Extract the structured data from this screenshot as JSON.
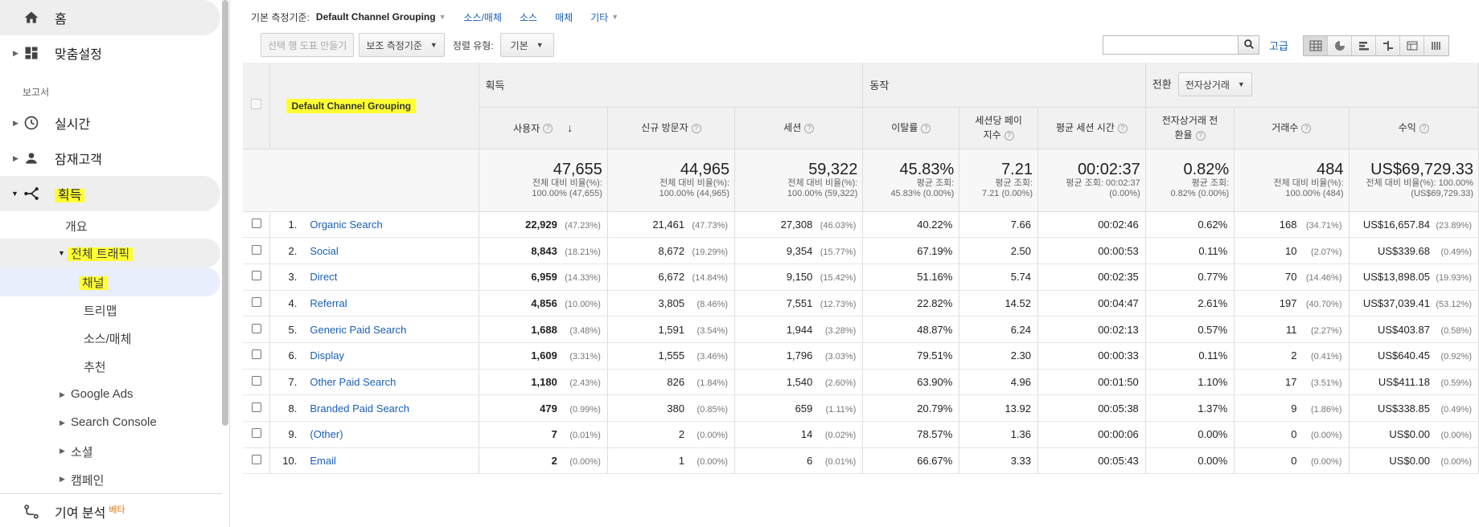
{
  "sidebar": {
    "home": "홈",
    "customization": "맞춤설정",
    "reports_label": "보고서",
    "realtime": "실시간",
    "audience": "잠재고객",
    "acquisition": "획득",
    "overview": "개요",
    "all_traffic": "전체 트래픽",
    "channels": "채널",
    "treemap": "트리맵",
    "source_medium": "소스/매체",
    "referrals": "추천",
    "google_ads": "Google Ads",
    "search_console": "Search Console",
    "social": "소셜",
    "campaigns": "캠페인",
    "attribution": "기여 분석",
    "beta": "베타"
  },
  "dimension_bar": {
    "label": "기본 측정기준:",
    "active": "Default Channel Grouping",
    "links": [
      "소스/매체",
      "소스",
      "매체",
      "기타"
    ]
  },
  "toolbar": {
    "create_tool": "선택 행 도표 만들기",
    "secondary": "보조 측정기준",
    "sort_label": "정렬 유형:",
    "sort_value": "기본",
    "advanced": "고급"
  },
  "table": {
    "dimension_header": "Default Channel Grouping",
    "groups": {
      "acquisition": "획득",
      "behavior": "동작",
      "conversion": "전환",
      "conversion_select": "전자상거래"
    },
    "columns": [
      "사용자",
      "신규 방문자",
      "세션",
      "이탈률",
      "세션당 페이지수",
      "평균 세션 시간",
      "전자상거래 전환율",
      "거래수",
      "수익"
    ],
    "col_users": "사용자",
    "col_new": "신규 방문자",
    "col_sessions": "세션",
    "col_bounce": "이탈률",
    "col_pps_1": "세션당 페이",
    "col_pps_2": "지수",
    "col_avgtime": "평균 세션 시간",
    "col_conv_1": "전자상거래 전",
    "col_conv_2": "환율",
    "col_tx": "거래수",
    "col_rev": "수익",
    "totals": {
      "users": "47,655",
      "users_sub1": "전체 대비 비율(%):",
      "users_sub2": "100.00% (47,655)",
      "new": "44,965",
      "new_sub1": "전체 대비 비율(%):",
      "new_sub2": "100.00% (44,965)",
      "sessions": "59,322",
      "sessions_sub1": "전체 대비 비율(%):",
      "sessions_sub2": "100.00% (59,322)",
      "bounce": "45.83%",
      "bounce_sub1": "평균 조회:",
      "bounce_sub2": "45.83% (0.00%)",
      "pps": "7.21",
      "pps_sub1": "평균 조회:",
      "pps_sub2": "7.21 (0.00%)",
      "avgtime": "00:02:37",
      "avgtime_sub1": "평균 조회: 00:02:37",
      "avgtime_sub2": "(0.00%)",
      "conv": "0.82%",
      "conv_sub1": "평균 조회:",
      "conv_sub2": "0.82% (0.00%)",
      "tx": "484",
      "tx_sub1": "전체 대비 비율(%):",
      "tx_sub2": "100.00% (484)",
      "rev": "US$69,729.33",
      "rev_sub1": "전체 대비 비율(%): 100.00%",
      "rev_sub2": "(US$69,729.33)"
    },
    "rows": [
      {
        "idx": "1.",
        "name": "Organic Search",
        "users": "22,929",
        "users_pct": "(47.23%)",
        "new": "21,461",
        "new_pct": "(47.73%)",
        "sessions": "27,308",
        "sessions_pct": "(46.03%)",
        "bounce": "40.22%",
        "pps": "7.66",
        "avgtime": "00:02:46",
        "conv": "0.62%",
        "tx": "168",
        "tx_pct": "(34.71%)",
        "rev": "US$16,657.84",
        "rev_pct": "(23.89%)"
      },
      {
        "idx": "2.",
        "name": "Social",
        "users": "8,843",
        "users_pct": "(18.21%)",
        "new": "8,672",
        "new_pct": "(19.29%)",
        "sessions": "9,354",
        "sessions_pct": "(15.77%)",
        "bounce": "67.19%",
        "pps": "2.50",
        "avgtime": "00:00:53",
        "conv": "0.11%",
        "tx": "10",
        "tx_pct": "(2.07%)",
        "rev": "US$339.68",
        "rev_pct": "(0.49%)"
      },
      {
        "idx": "3.",
        "name": "Direct",
        "users": "6,959",
        "users_pct": "(14.33%)",
        "new": "6,672",
        "new_pct": "(14.84%)",
        "sessions": "9,150",
        "sessions_pct": "(15.42%)",
        "bounce": "51.16%",
        "pps": "5.74",
        "avgtime": "00:02:35",
        "conv": "0.77%",
        "tx": "70",
        "tx_pct": "(14.46%)",
        "rev": "US$13,898.05",
        "rev_pct": "(19.93%)"
      },
      {
        "idx": "4.",
        "name": "Referral",
        "users": "4,856",
        "users_pct": "(10.00%)",
        "new": "3,805",
        "new_pct": "(8.46%)",
        "sessions": "7,551",
        "sessions_pct": "(12.73%)",
        "bounce": "22.82%",
        "pps": "14.52",
        "avgtime": "00:04:47",
        "conv": "2.61%",
        "tx": "197",
        "tx_pct": "(40.70%)",
        "rev": "US$37,039.41",
        "rev_pct": "(53.12%)"
      },
      {
        "idx": "5.",
        "name": "Generic Paid Search",
        "users": "1,688",
        "users_pct": "(3.48%)",
        "new": "1,591",
        "new_pct": "(3.54%)",
        "sessions": "1,944",
        "sessions_pct": "(3.28%)",
        "bounce": "48.87%",
        "pps": "6.24",
        "avgtime": "00:02:13",
        "conv": "0.57%",
        "tx": "11",
        "tx_pct": "(2.27%)",
        "rev": "US$403.87",
        "rev_pct": "(0.58%)"
      },
      {
        "idx": "6.",
        "name": "Display",
        "users": "1,609",
        "users_pct": "(3.31%)",
        "new": "1,555",
        "new_pct": "(3.46%)",
        "sessions": "1,796",
        "sessions_pct": "(3.03%)",
        "bounce": "79.51%",
        "pps": "2.30",
        "avgtime": "00:00:33",
        "conv": "0.11%",
        "tx": "2",
        "tx_pct": "(0.41%)",
        "rev": "US$640.45",
        "rev_pct": "(0.92%)"
      },
      {
        "idx": "7.",
        "name": "Other Paid Search",
        "users": "1,180",
        "users_pct": "(2.43%)",
        "new": "826",
        "new_pct": "(1.84%)",
        "sessions": "1,540",
        "sessions_pct": "(2.60%)",
        "bounce": "63.90%",
        "pps": "4.96",
        "avgtime": "00:01:50",
        "conv": "1.10%",
        "tx": "17",
        "tx_pct": "(3.51%)",
        "rev": "US$411.18",
        "rev_pct": "(0.59%)"
      },
      {
        "idx": "8.",
        "name": "Branded Paid Search",
        "users": "479",
        "users_pct": "(0.99%)",
        "new": "380",
        "new_pct": "(0.85%)",
        "sessions": "659",
        "sessions_pct": "(1.11%)",
        "bounce": "20.79%",
        "pps": "13.92",
        "avgtime": "00:05:38",
        "conv": "1.37%",
        "tx": "9",
        "tx_pct": "(1.86%)",
        "rev": "US$338.85",
        "rev_pct": "(0.49%)"
      },
      {
        "idx": "9.",
        "name": "(Other)",
        "users": "7",
        "users_pct": "(0.01%)",
        "new": "2",
        "new_pct": "(0.00%)",
        "sessions": "14",
        "sessions_pct": "(0.02%)",
        "bounce": "78.57%",
        "pps": "1.36",
        "avgtime": "00:00:06",
        "conv": "0.00%",
        "tx": "0",
        "tx_pct": "(0.00%)",
        "rev": "US$0.00",
        "rev_pct": "(0.00%)"
      },
      {
        "idx": "10.",
        "name": "Email",
        "users": "2",
        "users_pct": "(0.00%)",
        "new": "1",
        "new_pct": "(0.00%)",
        "sessions": "6",
        "sessions_pct": "(0.01%)",
        "bounce": "66.67%",
        "pps": "3.33",
        "avgtime": "00:05:43",
        "conv": "0.00%",
        "tx": "0",
        "tx_pct": "(0.00%)",
        "rev": "US$0.00",
        "rev_pct": "(0.00%)"
      }
    ]
  },
  "colors": {
    "accent": "#1a5fb4",
    "highlight": "#ffff33",
    "sidebar_active": "#e8eefc",
    "header_bg": "#f1f1f1"
  },
  "icons": [
    "home-icon",
    "dashboard-icon",
    "clock-icon",
    "person-icon",
    "acquisition-icon",
    "attribution-icon",
    "search-icon",
    "grid-view-icon",
    "pie-view-icon",
    "bar-view-icon",
    "comparison-view-icon",
    "pivot-view-icon",
    "term-cloud-icon"
  ]
}
